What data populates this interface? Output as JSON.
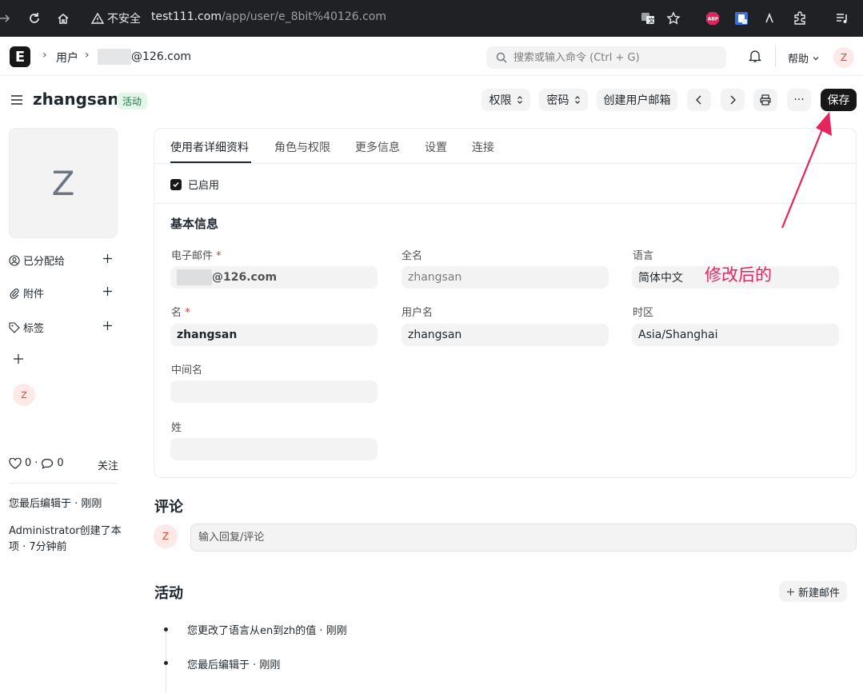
{
  "browser": {
    "insecure_label": "不安全",
    "url_host": "test111.com",
    "url_path": "/app/user/e_8bit%40126.com",
    "ext_abp": "ABP"
  },
  "navbar": {
    "logo_letter": "E",
    "breadcrumb_users": "用户",
    "breadcrumb_email_suffix": "@126.com",
    "search_placeholder": "搜索或输入命令 (Ctrl + G)",
    "help_label": "帮助",
    "avatar_letter": "Z"
  },
  "header": {
    "title": "zhangsan",
    "status_badge": "活动",
    "btn_permissions": "权限",
    "btn_password": "密码",
    "btn_create_mailbox": "创建用户邮箱",
    "btn_more": "···",
    "btn_save": "保存"
  },
  "sidebar": {
    "avatar_letter": "Z",
    "assigned_label": "已分配给",
    "attachments_label": "附件",
    "tags_label": "标签",
    "small_avatar_letter": "Z",
    "likes_count": "0",
    "comments_count": "0",
    "follow_label": "关注",
    "last_edit": "您最后编辑于 · 刚刚",
    "created_line1": "Administrator创建了本",
    "created_line2": "项 · 7分钟前"
  },
  "tabs": [
    "使用者详细资料",
    "角色与权限",
    "更多信息",
    "设置",
    "连接"
  ],
  "form": {
    "enabled_label": "已启用",
    "section_title": "基本信息",
    "email_label": "电子邮件",
    "email_value_suffix": "@126.com",
    "fullname_label": "全名",
    "fullname_value": "zhangsan",
    "language_label": "语言",
    "language_value": "简体中文",
    "firstname_label": "名",
    "firstname_value": "zhangsan",
    "username_label": "用户名",
    "username_value": "zhangsan",
    "timezone_label": "时区",
    "timezone_value": "Asia/Shanghai",
    "middlename_label": "中间名",
    "middlename_value": "",
    "lastname_label": "姓",
    "lastname_value": "",
    "required_mark": "*"
  },
  "annotation": {
    "text": "修改后的",
    "color": "#e8245f"
  },
  "comments": {
    "title": "评论",
    "avatar_letter": "Z",
    "input_placeholder": "输入回复/评论"
  },
  "activity": {
    "title": "活动",
    "new_email_label": "新建邮件",
    "items": [
      "您更改了语言从en到zh的值 · 刚刚",
      "您最后编辑于 · 刚刚"
    ]
  },
  "colors": {
    "accent_dark": "#171717",
    "badge_green": "#16794c",
    "avatar_red": "#d4493f"
  }
}
